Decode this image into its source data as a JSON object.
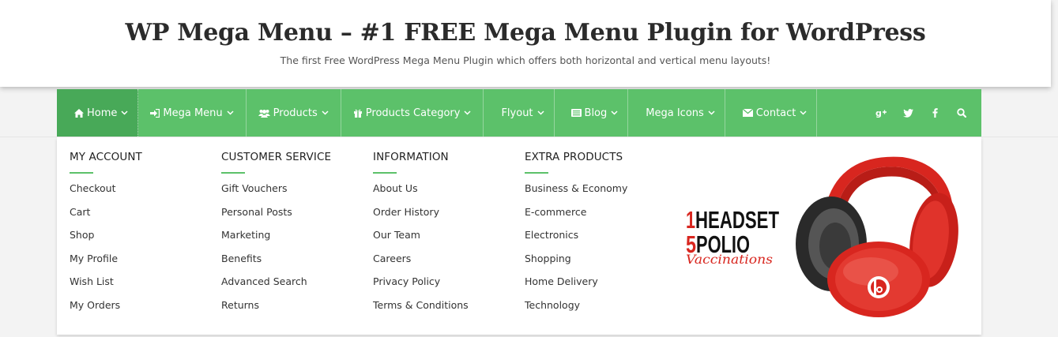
{
  "header": {
    "title": "WP Mega Menu – #1 FREE Mega Menu Plugin for WordPress",
    "tagline": "The first Free WordPress Mega Menu Plugin which offers both horizontal and vertical menu layouts!"
  },
  "nav": {
    "items": [
      {
        "label": "Home",
        "icon": "home-icon"
      },
      {
        "label": "Mega Menu",
        "icon": "sign-in-icon"
      },
      {
        "label": "Products",
        "icon": "users-icon"
      },
      {
        "label": "Products Category",
        "icon": "gift-icon"
      },
      {
        "label": "Flyout",
        "icon": ""
      },
      {
        "label": "Blog",
        "icon": "list-icon"
      },
      {
        "label": "Mega Icons",
        "icon": ""
      },
      {
        "label": "Contact",
        "icon": "envelope-icon"
      }
    ],
    "social": [
      "google-plus-icon",
      "twitter-icon",
      "facebook-icon",
      "search-icon"
    ]
  },
  "mega": {
    "columns": [
      {
        "title": "MY ACCOUNT",
        "links": [
          "Checkout",
          "Cart",
          "Shop",
          "My Profile",
          "Wish List",
          "My Orders"
        ]
      },
      {
        "title": "CUSTOMER SERVICE",
        "links": [
          "Gift Vouchers",
          "Personal Posts",
          "Marketing",
          "Benefits",
          "Advanced Search",
          "Returns"
        ]
      },
      {
        "title": "INFORMATION",
        "links": [
          "About Us",
          "Order History",
          "Our Team",
          "Careers",
          "Privacy Policy",
          "Terms & Conditions"
        ]
      },
      {
        "title": "EXTRA PRODUCTS",
        "links": [
          "Business & Economy",
          "E-commerce",
          "Electronics",
          "Shopping",
          "Home Delivery",
          "Technology"
        ]
      }
    ],
    "promo": {
      "line1_num": "1",
      "line1_text": "HEADSET",
      "line2_num": "5",
      "line2_text": "POLIO",
      "line3": "Vaccinations"
    }
  },
  "colors": {
    "nav_bg": "#5cc16a",
    "nav_active": "#48a958",
    "accent_line": "#5cc16a",
    "headphone_red": "#d8261f"
  }
}
